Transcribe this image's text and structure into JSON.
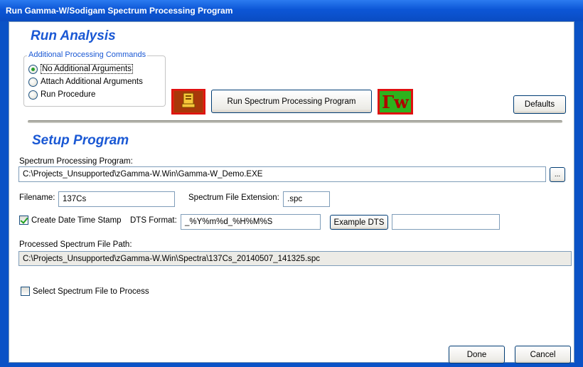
{
  "window": {
    "title": "Run Gamma-W/Sodigam Spectrum Processing Program"
  },
  "run_analysis": {
    "title": "Run Analysis",
    "group_legend": "Additional Processing Commands",
    "options": [
      {
        "label": "No Additional Arguments",
        "checked": true
      },
      {
        "label": "Attach Additional Arguments",
        "checked": false
      },
      {
        "label": "Run Procedure",
        "checked": false
      }
    ],
    "run_button": "Run Spectrum Processing Program",
    "defaults_button": "Defaults",
    "gamma_w_logo_text": "Γw"
  },
  "setup": {
    "title": "Setup Program",
    "program_label": "Spectrum Processing Program:",
    "program_path": "C:\\Projects_Unsupported\\zGamma-W.Win\\Gamma-W_Demo.EXE",
    "browse_button": "...",
    "filename_label": "Filename:",
    "filename_value": "137Cs",
    "extension_label": "Spectrum File Extension:",
    "extension_value": ".spc",
    "dts_checkbox_label": "Create Date Time Stamp",
    "dts_checked": true,
    "dts_format_label": "DTS Format:",
    "dts_format_value": "_%Y%m%d_%H%M%S",
    "example_dts_button": "Example DTS",
    "example_dts_value": "",
    "processed_path_label": "Processed Spectrum File Path:",
    "processed_path_value": "C:\\Projects_Unsupported\\zGamma-W.Win\\Spectra\\137Cs_20140507_141325.spc",
    "select_file_label": "Select Spectrum File to Process",
    "select_file_checked": false
  },
  "footer": {
    "done_button": "Done",
    "cancel_button": "Cancel"
  },
  "colors": {
    "section_title": "#1a58d4",
    "titlebar": "#0c56d6",
    "icon_border": "#e01010"
  }
}
